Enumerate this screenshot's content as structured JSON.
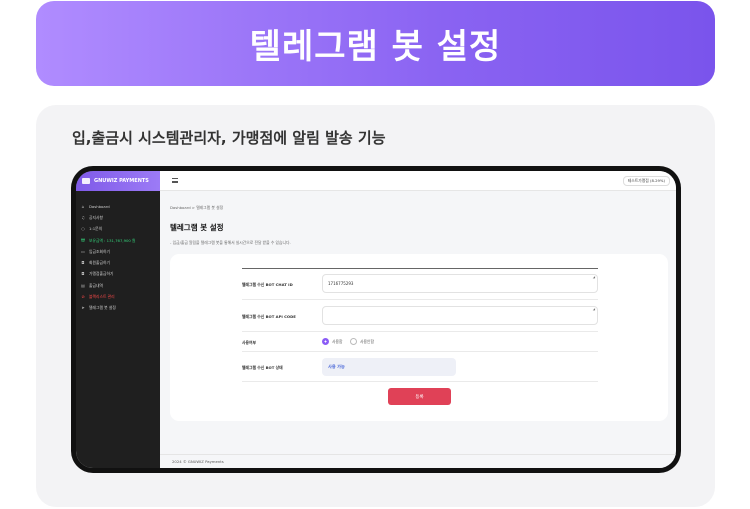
{
  "banner": {
    "title": "텔레그램 봇 설정"
  },
  "panel": {
    "description": "입,출금시 시스템관리자, 가맹점에 알림 발송 기능"
  },
  "app": {
    "brand": "GNUWIZ PAYMENTS",
    "user_chip": "테스트가맹점 (8.29%)",
    "sidebar": {
      "items": [
        {
          "label": "Dashboard",
          "icon": "home-icon",
          "style": "normal"
        },
        {
          "label": "공지사항",
          "icon": "bell-icon",
          "style": "normal"
        },
        {
          "label": "1:1문의",
          "icon": "circle-icon",
          "style": "normal"
        },
        {
          "label": "보유금액 : 131,767,900 원",
          "icon": "won-icon",
          "style": "green"
        },
        {
          "label": "입금조회하기",
          "icon": "card-icon",
          "style": "normal"
        },
        {
          "label": "회원출금하기",
          "icon": "wallet-icon",
          "style": "normal"
        },
        {
          "label": "가맹점출금하기",
          "icon": "wallet-icon",
          "style": "normal"
        },
        {
          "label": "출금내역",
          "icon": "list-icon",
          "style": "normal"
        },
        {
          "label": "블랙리스트 관리",
          "icon": "block-icon",
          "style": "red"
        },
        {
          "label": "텔레그램 봇 설정",
          "icon": "send-icon",
          "style": "normal"
        }
      ]
    },
    "breadcrumb": "Dashboard  >  텔레그램 봇 설정",
    "page_title": "텔레그램 봇 설정",
    "page_description": "- 입금/출금 알림을 텔레그램 봇을 통해서 실시간으로 전달 받을 수 있습니다.",
    "form": {
      "chat_id_label": "텔레그램 수신 BOT CHAT ID",
      "chat_id_value": "1716775293",
      "api_code_label": "텔레그램 수신 BOT API CODE",
      "api_code_value": "",
      "usage_label": "사용여부",
      "usage_options": [
        "사용함",
        "사용안함"
      ],
      "usage_selected": "사용함",
      "status_label": "텔레그램 수신 BOT 상태",
      "status_value": "사용 가능",
      "submit_label": "등록"
    },
    "footer": "2024 © GNUWIZ Payments"
  },
  "colors": {
    "accent": "#8a63f2",
    "submit": "#e04157",
    "positive": "#34d27a",
    "danger": "#ff4a4a"
  }
}
